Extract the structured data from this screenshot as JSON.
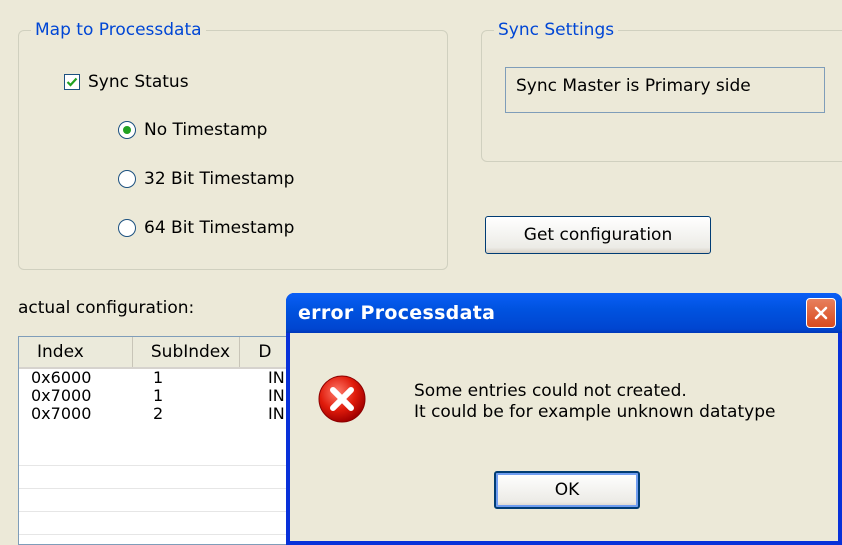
{
  "map_group": {
    "title": "Map to Processdata",
    "sync_status": {
      "label": "Sync Status",
      "checked": true
    },
    "radios": [
      {
        "label": "No Timestamp",
        "selected": true
      },
      {
        "label": "32 Bit Timestamp",
        "selected": false
      },
      {
        "label": "64 Bit Timestamp",
        "selected": false
      }
    ]
  },
  "sync_group": {
    "title": "Sync Settings",
    "value": "Sync Master is Primary side"
  },
  "get_config_button": "Get configuration",
  "actual_label": "actual configuration:",
  "table": {
    "columns": [
      "Index",
      "SubIndex",
      "D"
    ],
    "rows": [
      [
        "0x6000",
        "1",
        "IN"
      ],
      [
        "0x7000",
        "1",
        "IN"
      ],
      [
        "0x7000",
        "2",
        "IN"
      ]
    ]
  },
  "dialog": {
    "title": "error Processdata",
    "line1": "Some entries could not created.",
    "line2": "It could be for example unknown datatype",
    "ok_label": "OK"
  },
  "colors": {
    "accent": "#0046d5",
    "error_icon": "#d40000",
    "radio_dot": "#21a121"
  }
}
